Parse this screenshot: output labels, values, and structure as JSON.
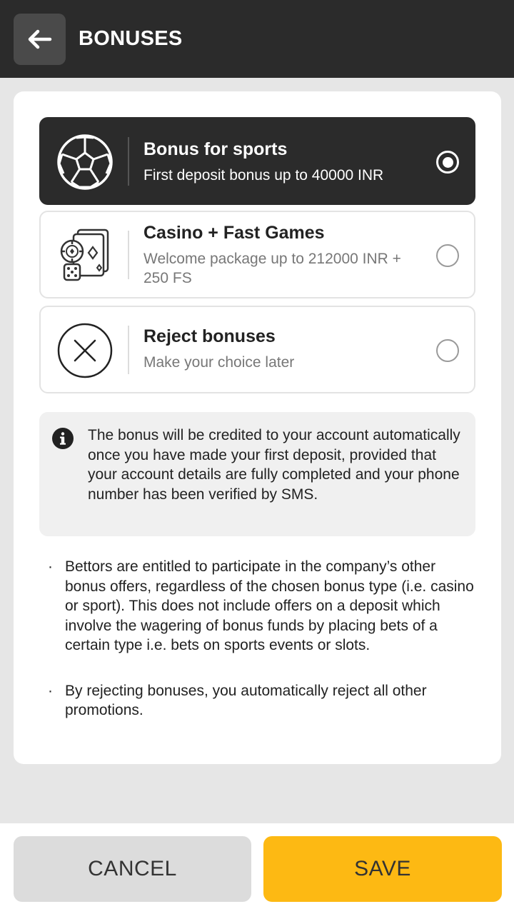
{
  "header": {
    "title": "BONUSES",
    "back_icon": "arrow-left-icon"
  },
  "options": [
    {
      "icon": "soccer-ball-icon",
      "title": "Bonus for sports",
      "subtitle": "First deposit bonus up to 40000 INR",
      "selected": true
    },
    {
      "icon": "casino-chip-cards-dice-icon",
      "title": "Casino + Fast Games",
      "subtitle": "Welcome package up to 212000 INR + 250 FS",
      "selected": false
    },
    {
      "icon": "reject-x-circle-icon",
      "title": "Reject bonuses",
      "subtitle": "Make your choice later",
      "selected": false
    }
  ],
  "info": {
    "icon": "info-icon",
    "text": "The bonus will be credited to your account automatically once you have made your first deposit, provided that your account details are fully completed and your phone number has been verified by SMS."
  },
  "bullets": [
    "Bettors are entitled to participate in the company’s other bonus offers, regardless of the chosen bonus type (i.e. casino or sport). This does not include offers on a deposit which involve the wagering of bonus funds by placing bets of a certain type i.e. bets on sports events or slots.",
    "By rejecting bonuses, you automatically reject all other promotions."
  ],
  "footer": {
    "cancel_label": "CANCEL",
    "save_label": "SAVE"
  },
  "colors": {
    "header_bg": "#2b2b2b",
    "selected_bg": "#2b2b2b",
    "accent": "#fdb913",
    "cancel_bg": "#dcdcdc",
    "page_bg": "#e6e6e6"
  }
}
